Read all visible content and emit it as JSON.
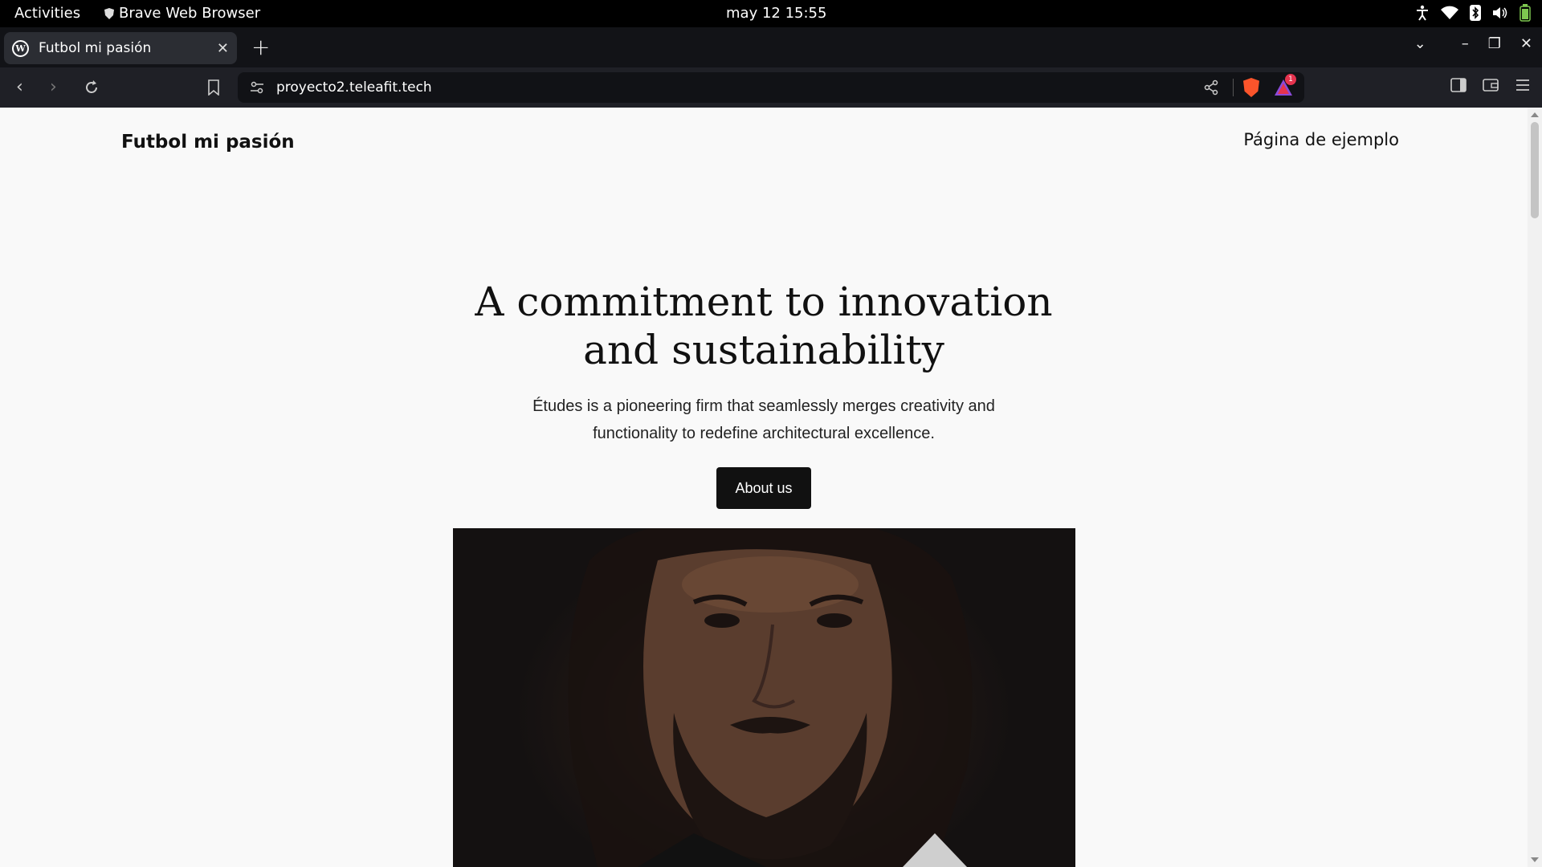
{
  "system_bar": {
    "activities_label": "Activities",
    "app_label": "Brave Web Browser",
    "clock": "may 12  15:55",
    "tray_icons": [
      "accessibility-icon",
      "wifi-icon",
      "bluetooth-icon",
      "volume-icon",
      "battery-icon"
    ]
  },
  "browser": {
    "tab": {
      "title": "Futbol mi pasión",
      "icon": "wordpress-icon"
    },
    "url": "proyecto2.teleafit.tech",
    "rewards_badge": "1"
  },
  "page": {
    "site_title": "Futbol mi pasión",
    "nav_link": "Página de ejemplo",
    "hero_heading_line1": "A commitment to innovation",
    "hero_heading_line2": "and sustainability",
    "hero_subtext": "Études is a pioneering firm that seamlessly merges creativity and functionality to redefine architectural excellence.",
    "hero_button": "About us"
  },
  "colors": {
    "page_bg": "#f9f9f9",
    "button_bg": "#111111",
    "browser_chrome": "#1f2026",
    "brave_accent": "#fb542b"
  }
}
